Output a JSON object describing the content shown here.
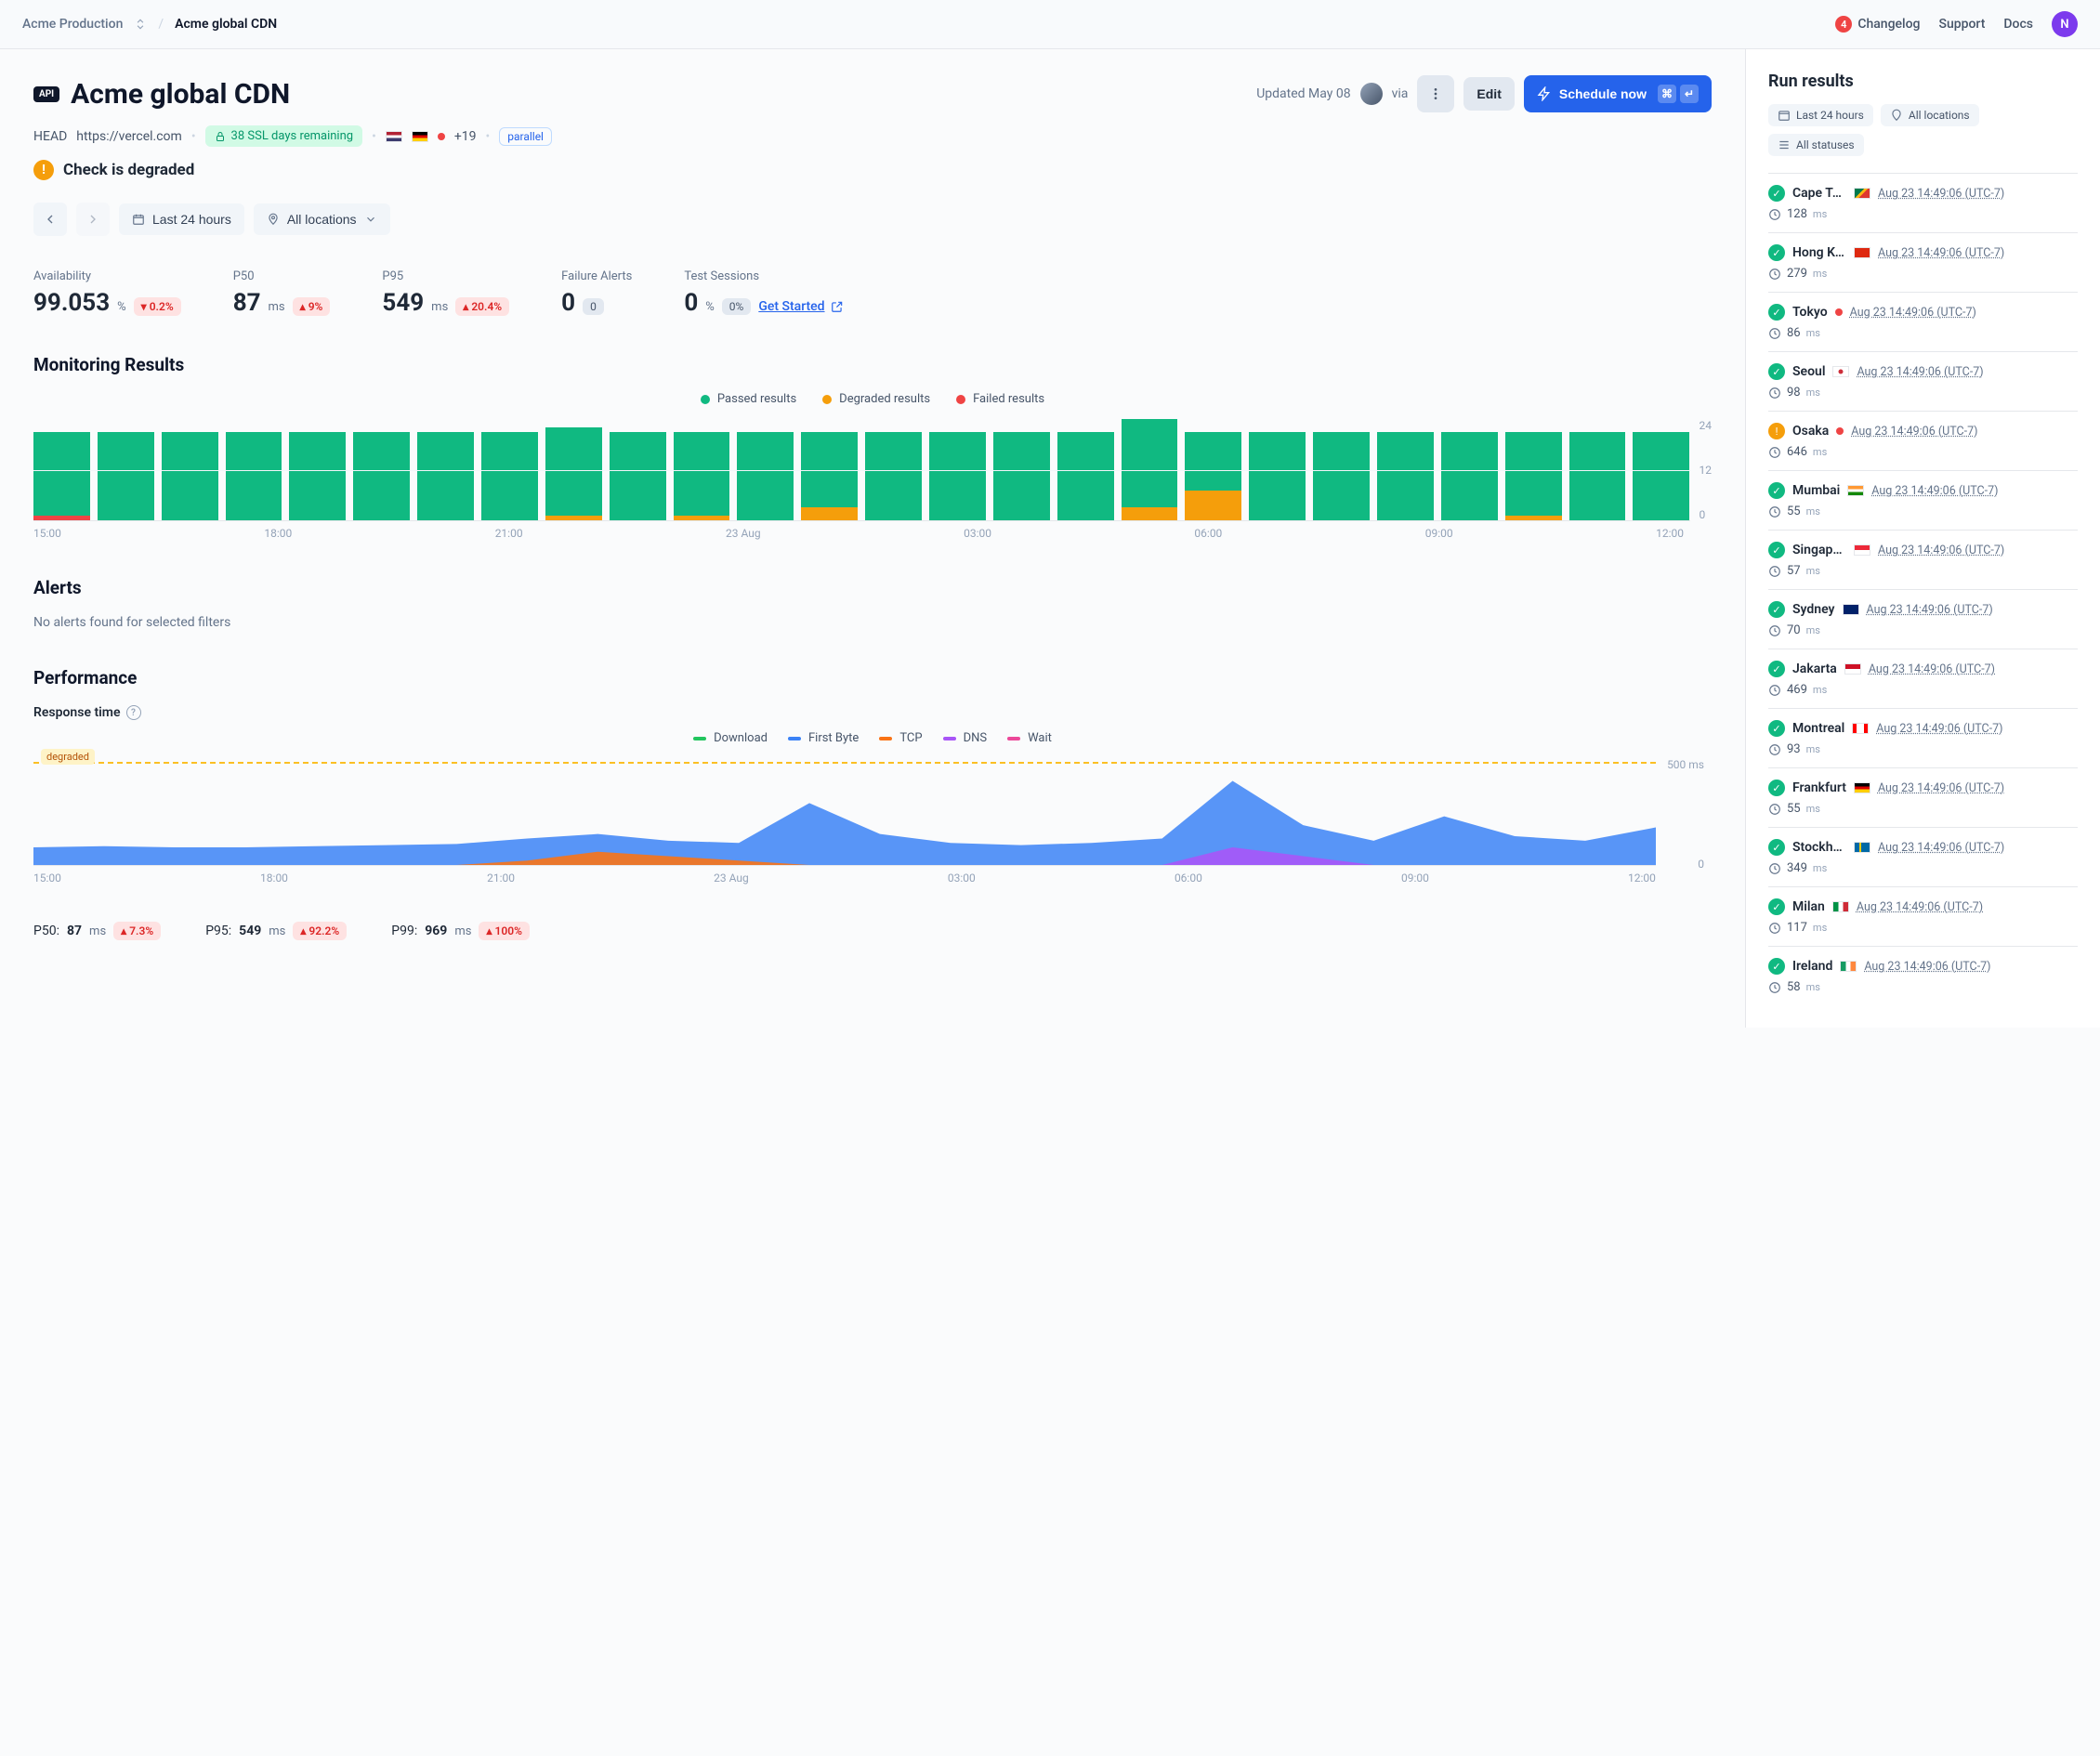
{
  "topbar": {
    "project": "Acme Production",
    "current": "Acme global CDN",
    "changelog_count": "4",
    "links": {
      "changelog": "Changelog",
      "support": "Support",
      "docs": "Docs"
    },
    "avatar_initial": "N"
  },
  "header": {
    "badge": "API",
    "title": "Acme global CDN",
    "updated": "Updated May 08",
    "via": "via",
    "edit": "Edit",
    "schedule": "Schedule now"
  },
  "meta": {
    "method": "HEAD",
    "url": "https://vercel.com",
    "ssl": "38 SSL days remaining",
    "extra_locations": "+19",
    "parallel": "parallel"
  },
  "status": {
    "label": "Check is degraded"
  },
  "filters": {
    "time": "Last 24 hours",
    "locations": "All locations"
  },
  "stats": {
    "availability": {
      "label": "Availability",
      "value": "99.053",
      "unit": "%",
      "delta": "0.2%"
    },
    "p50": {
      "label": "P50",
      "value": "87",
      "unit": "ms",
      "delta": "9%"
    },
    "p95": {
      "label": "P95",
      "value": "549",
      "unit": "ms",
      "delta": "20.4%"
    },
    "failure": {
      "label": "Failure Alerts",
      "value": "0",
      "badge": "0"
    },
    "sessions": {
      "label": "Test Sessions",
      "value": "0",
      "unit": "%",
      "badge": "0%",
      "cta": "Get Started"
    }
  },
  "monitoring": {
    "title": "Monitoring Results",
    "legend": {
      "passed": "Passed results",
      "degraded": "Degraded results",
      "failed": "Failed results"
    }
  },
  "chart_data": {
    "type": "bar",
    "ylabel": "",
    "ylim": [
      0,
      24
    ],
    "yticks": [
      24,
      12,
      0
    ],
    "categories": [
      "15:00",
      "",
      "",
      "18:00",
      "",
      "",
      "21:00",
      "",
      "",
      "23 Aug",
      "",
      "",
      "03:00",
      "",
      "",
      "06:00",
      "",
      "",
      "09:00",
      "",
      "",
      "12:00",
      "",
      ""
    ],
    "series": [
      {
        "name": "Passed",
        "color": "#10b981",
        "values": [
          20,
          21,
          21,
          21,
          21,
          21,
          21,
          21,
          21,
          21,
          20,
          21,
          18,
          21,
          21,
          21,
          21,
          21,
          14,
          21,
          21,
          21,
          21,
          20,
          21,
          21
        ]
      },
      {
        "name": "Degraded",
        "color": "#f59e0b",
        "values": [
          0,
          0,
          0,
          0,
          0,
          0,
          0,
          0,
          1,
          0,
          1,
          0,
          3,
          0,
          0,
          0,
          0,
          3,
          7,
          0,
          0,
          0,
          0,
          1,
          0,
          0
        ]
      },
      {
        "name": "Failed",
        "color": "#ef4444",
        "values": [
          1,
          0,
          0,
          0,
          0,
          0,
          0,
          0,
          0,
          0,
          0,
          0,
          0,
          0,
          0,
          0,
          0,
          0,
          0,
          0,
          0,
          0,
          0,
          0,
          0,
          0
        ]
      }
    ],
    "x_ticks_display": [
      "15:00",
      "18:00",
      "21:00",
      "23 Aug",
      "03:00",
      "06:00",
      "09:00",
      "12:00"
    ]
  },
  "alerts": {
    "title": "Alerts",
    "empty": "No alerts found for selected filters"
  },
  "performance": {
    "title": "Performance",
    "subtitle": "Response time",
    "legend": {
      "download": "Download",
      "first_byte": "First Byte",
      "tcp": "TCP",
      "dns": "DNS",
      "wait": "Wait"
    },
    "degraded_label": "degraded",
    "y_labels": {
      "top": "500 ms",
      "bottom": "0"
    },
    "x_ticks": [
      "15:00",
      "18:00",
      "21:00",
      "23 Aug",
      "03:00",
      "06:00",
      "09:00",
      "12:00"
    ],
    "area_data": {
      "type": "area",
      "ylim": [
        0,
        500
      ],
      "x_index": [
        0,
        1,
        2,
        3,
        4,
        5,
        6,
        7,
        8,
        9,
        10,
        11,
        12,
        13,
        14,
        15,
        16,
        17,
        18,
        19,
        20,
        21,
        22,
        23
      ],
      "series": [
        {
          "name": "First Byte",
          "color": "#3b82f6",
          "values": [
            80,
            85,
            80,
            80,
            85,
            90,
            95,
            120,
            140,
            110,
            100,
            280,
            140,
            100,
            90,
            100,
            120,
            380,
            180,
            110,
            220,
            130,
            110,
            170
          ]
        },
        {
          "name": "TCP",
          "color": "#f97316",
          "values": [
            0,
            0,
            0,
            0,
            0,
            0,
            0,
            20,
            60,
            40,
            20,
            0,
            0,
            0,
            0,
            0,
            0,
            0,
            0,
            0,
            0,
            0,
            0,
            0
          ]
        },
        {
          "name": "DNS",
          "color": "#a855f7",
          "values": [
            0,
            0,
            0,
            0,
            0,
            0,
            0,
            0,
            0,
            0,
            0,
            0,
            0,
            0,
            0,
            0,
            0,
            80,
            40,
            0,
            0,
            0,
            0,
            0
          ]
        }
      ]
    },
    "stats": {
      "p50": {
        "label": "P50:",
        "value": "87",
        "unit": "ms",
        "delta": "7.3%"
      },
      "p95": {
        "label": "P95:",
        "value": "549",
        "unit": "ms",
        "delta": "92.2%"
      },
      "p99": {
        "label": "P99:",
        "value": "969",
        "unit": "ms",
        "delta": "100%"
      }
    }
  },
  "sidebar": {
    "title": "Run results",
    "chips": {
      "time": "Last 24 hours",
      "locations": "All locations",
      "statuses": "All statuses"
    },
    "timestamp": "Aug 23 14:49:06 (UTC-7)",
    "runs": [
      {
        "status": "ok",
        "city": "Cape Town",
        "flag": "za",
        "duration": "128",
        "dot": false
      },
      {
        "status": "ok",
        "city": "Hong Kong",
        "flag": "cn",
        "duration": "279",
        "dot": false
      },
      {
        "status": "ok",
        "city": "Tokyo",
        "flag": "jp",
        "duration": "86",
        "dot": true
      },
      {
        "status": "ok",
        "city": "Seoul",
        "flag": "kr",
        "duration": "98",
        "dot": false
      },
      {
        "status": "warn",
        "city": "Osaka",
        "flag": "jp",
        "duration": "646",
        "dot": true
      },
      {
        "status": "ok",
        "city": "Mumbai",
        "flag": "in",
        "duration": "55",
        "dot": false
      },
      {
        "status": "ok",
        "city": "Singapore",
        "flag": "sg",
        "duration": "57",
        "dot": false
      },
      {
        "status": "ok",
        "city": "Sydney",
        "flag": "au",
        "duration": "70",
        "dot": false
      },
      {
        "status": "ok",
        "city": "Jakarta",
        "flag": "id",
        "duration": "469",
        "dot": false
      },
      {
        "status": "ok",
        "city": "Montreal",
        "flag": "ca",
        "duration": "93",
        "dot": false
      },
      {
        "status": "ok",
        "city": "Frankfurt",
        "flag": "de",
        "duration": "55",
        "dot": false
      },
      {
        "status": "ok",
        "city": "Stockholm",
        "flag": "se",
        "duration": "349",
        "dot": false
      },
      {
        "status": "ok",
        "city": "Milan",
        "flag": "it",
        "duration": "117",
        "dot": false
      },
      {
        "status": "ok",
        "city": "Ireland",
        "flag": "ie",
        "duration": "58",
        "dot": false
      }
    ]
  }
}
